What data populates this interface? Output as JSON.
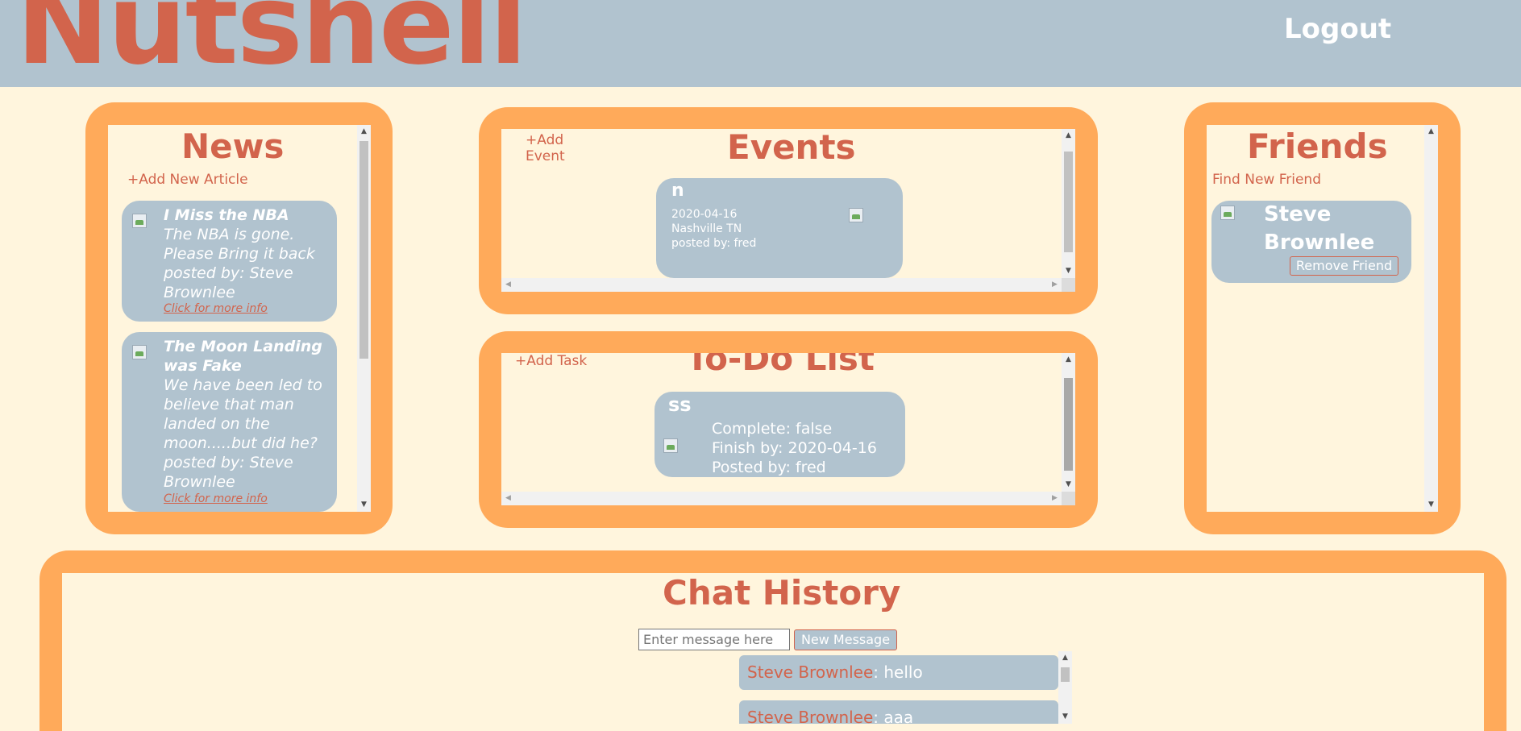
{
  "header": {
    "logo": "Nutshell",
    "logout_label": "Logout"
  },
  "colors": {
    "header_bg": "#b1c3cf",
    "page_bg": "#fff5dd",
    "panel_orange": "#ffaa5a",
    "accent": "#d2644c",
    "card_bg": "#b1c3cf"
  },
  "news": {
    "title": "News",
    "add_label": "+Add New Article",
    "articles": [
      {
        "title": "I Miss the NBA",
        "body": "The NBA is gone. Please Bring it back",
        "posted": "posted by: Steve Brownlee",
        "more": "Click for more info"
      },
      {
        "title": "The Moon Landing was Fake",
        "body": "We have been led to believe that man landed on the moon.....but did he?",
        "posted": "posted by: Steve Brownlee",
        "more": "Click for more info"
      }
    ]
  },
  "events": {
    "title": "Events",
    "add_label": "+Add Event",
    "items": [
      {
        "name": "n",
        "date": "2020-04-16",
        "location": "Nashville TN",
        "posted": "posted by: fred"
      }
    ]
  },
  "todo": {
    "title": "To-Do List",
    "add_label": "+Add Task",
    "items": [
      {
        "name": "ss",
        "complete": "Complete: false",
        "finish": "Finish by: 2020-04-16",
        "posted": "Posted by: fred"
      }
    ]
  },
  "friends": {
    "title": "Friends",
    "find_label": "Find New Friend",
    "items": [
      {
        "name": "Steve Brownlee",
        "remove_label": "Remove Friend"
      }
    ]
  },
  "chat": {
    "title": "Chat History",
    "input_placeholder": "Enter message here",
    "send_label": "New Message",
    "messages": [
      {
        "author": "Steve Brownlee",
        "text": ": hello"
      },
      {
        "author": "Steve Brownlee",
        "text": ": aaa"
      }
    ]
  }
}
